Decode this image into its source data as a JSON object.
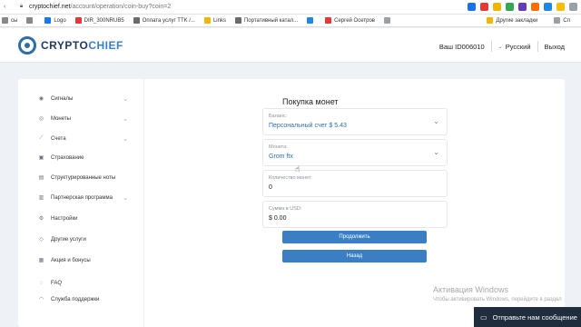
{
  "browser": {
    "url_host": "cryptochief.net",
    "url_path": "/account/operation/coin-buy?coin=2",
    "bookmarks": [
      {
        "label": "сы",
        "color": "#888888"
      },
      {
        "label": "",
        "color": "#888888"
      },
      {
        "label": "Logo",
        "color": "#1877f2"
      },
      {
        "label": "DIR_300NRUB5",
        "color": "#e53935"
      },
      {
        "label": "Оплата услуг TTK /...",
        "color": "#6b6b6b"
      },
      {
        "label": "Links",
        "color": "#f4b400"
      },
      {
        "label": "Портативный катал...",
        "color": "#6b6b6b"
      },
      {
        "label": "",
        "color": "#1e88e5"
      },
      {
        "label": "Сергей Осетров",
        "color": "#e53935"
      },
      {
        "label": "",
        "color": "#9aa0a6"
      }
    ],
    "bookmarks_right": [
      "Другие закладки",
      "Сп"
    ],
    "extension_colors": [
      "#1a73e8",
      "#e53935",
      "#f4b400",
      "#34a853",
      "#673ab7",
      "#ff6d00",
      "#1e88e5",
      "#fbbc04",
      "#9aa0a6"
    ]
  },
  "header": {
    "logo_part1": "CRYPTO",
    "logo_part2": "CHIEF",
    "user_id": "Ваш ID006010",
    "language": "Русский",
    "logout": "Выход"
  },
  "sidebar": {
    "items": [
      {
        "label": "Сигналы",
        "icon": "signal-icon",
        "has_chevron": true
      },
      {
        "label": "Монеты",
        "icon": "coins-icon",
        "has_chevron": true
      },
      {
        "label": "Счета",
        "icon": "chart-line-icon",
        "has_chevron": true
      },
      {
        "label": "Страхование",
        "icon": "box-icon",
        "has_chevron": false
      },
      {
        "label": "Структурированные ноты",
        "icon": "notes-icon",
        "has_chevron": false
      },
      {
        "label": "Партнерская программа",
        "icon": "briefcase-icon",
        "has_chevron": true
      },
      {
        "label": "Настройки",
        "icon": "gear-icon",
        "has_chevron": false
      },
      {
        "label": "Другие услуги",
        "icon": "tag-icon",
        "has_chevron": false
      },
      {
        "label": "Акция и бонусы",
        "icon": "gift-icon",
        "has_chevron": false
      },
      {
        "label": "FAQ",
        "icon": "chat-icon",
        "has_chevron": false
      },
      {
        "label": "Служба поддержки",
        "icon": "headset-icon",
        "has_chevron": false
      }
    ]
  },
  "form": {
    "title": "Покупка монет",
    "balance_label": "Баланс:",
    "balance_value": "Персональный счет $ 5.43",
    "coin_label": "Монета:",
    "coin_value": "Grom ftx",
    "quantity_label": "Количество монет:",
    "quantity_value": "0",
    "sum_label": "Сумма в USD:",
    "sum_value": "$ 0.00",
    "continue_button": "Продолжить",
    "back_button": "Назад"
  },
  "watermark": {
    "title": "Активация Windows",
    "subtitle": "Чтобы активировать Windows, перейдите в раздел"
  },
  "chat": {
    "label": "Отправьте нам сообщение"
  }
}
